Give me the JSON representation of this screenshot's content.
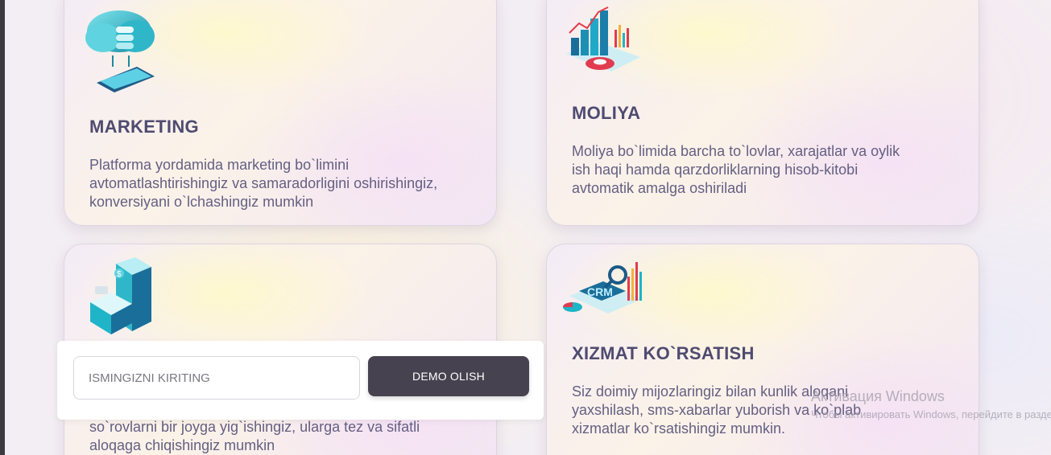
{
  "cards": [
    {
      "icon": "cloud-database-phone-icon",
      "title": "MARKETING",
      "description": "Platforma yordamida marketing bo`limini avtomatlashtirishingiz va samaradorligini oshirishingiz, konversiyani o`lchashingiz mumkin"
    },
    {
      "icon": "finance-chart-icon",
      "title": "MOLIYA",
      "description": "Moliya bo`limida barcha to`lovlar, xarajatlar va oylik ish haqi hamda qarzdorliklarning hisob-kitobi avtomatik amalga oshiriladi"
    },
    {
      "icon": "phone-payment-icon",
      "title": "",
      "description": "so`rovlarni bir joyga yig`ishingiz, ularga tez va sifatli aloqaga chiqishingiz mumkin"
    },
    {
      "icon": "crm-analytics-icon",
      "title": "XIZMAT KO`RSATISH",
      "description": "Siz doimiy mijozlaringiz bilan kunlik aloqani yaxshilash, sms-xabarlar yuborish va ko`plab xizmatlar ko`rsatishingiz mumkin."
    }
  ],
  "demo_form": {
    "name_placeholder": "ISMINGIZNI KIRITING",
    "button_label": "DEMO OLISH"
  },
  "watermark": {
    "title": "Активация Windows",
    "text": "Чтобы активировать Windows, перейдите в раздел \"Параметры\"."
  },
  "colors": {
    "title": "#4f4b70",
    "text": "#646082",
    "button": "#47424f",
    "accent_teal": "#1fb4c8"
  }
}
